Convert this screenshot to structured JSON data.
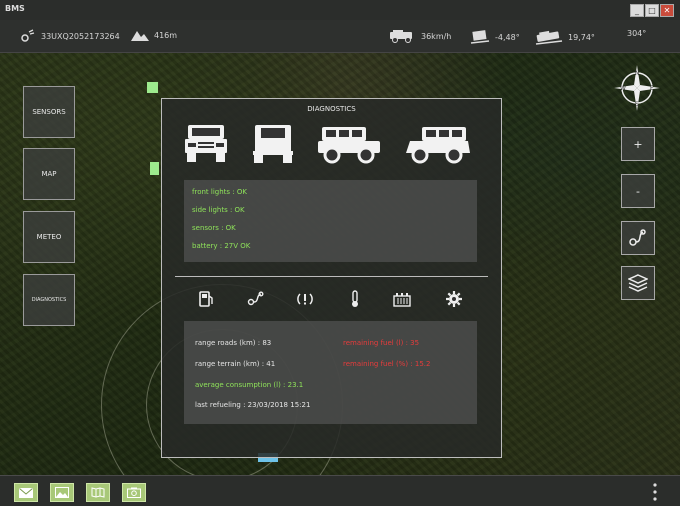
{
  "window": {
    "app_title": "BMS"
  },
  "toolbar": {
    "coordinates": "33UXQ2052173264",
    "altitude": "416m",
    "speed": "36km/h",
    "pitch": "-4,48°",
    "roll": "19,74°",
    "heading": "304°"
  },
  "sidebar": {
    "items": [
      {
        "label": "SENSORS"
      },
      {
        "label": "MAP"
      },
      {
        "label": "METEO"
      },
      {
        "label": "DIAGNOSTICS"
      }
    ]
  },
  "map_controls": {
    "zoom_in": "+",
    "zoom_out": "-"
  },
  "diagnostics": {
    "title": "DIAGNOSTICS",
    "vehicle_views": [
      "front",
      "rear",
      "side-left",
      "side-right"
    ],
    "status": [
      {
        "text": "front lights : OK"
      },
      {
        "text": "side lights : OK"
      },
      {
        "text": "sensors : OK"
      },
      {
        "text": "battery : 27V OK"
      }
    ],
    "categories": [
      "fuel-icon",
      "gps-route-icon",
      "warning-icon",
      "thermometer-icon",
      "battery-icon",
      "settings-gear-icon"
    ],
    "fuel": {
      "range_roads": "range roads (km) : 83",
      "range_terrain": "range terrain (km) : 41",
      "average_consumption": "average consumption (l) : 23.1",
      "last_refueling": "last refueling : 23/03/2018  15:21",
      "remaining_fuel": "remaining fuel (l) : 35",
      "remaining_fuel_pct": "remaining fuel (%) : 15.2"
    }
  },
  "colors": {
    "status_ok": "#8fe35a",
    "warning": "#e63c3c",
    "panel_bg": "#2a2c2a",
    "bottom_accent": "#a8c878"
  },
  "bottom_bar": {
    "buttons": [
      "mail-icon",
      "image-icon",
      "map-book-icon",
      "camera-icon"
    ]
  }
}
